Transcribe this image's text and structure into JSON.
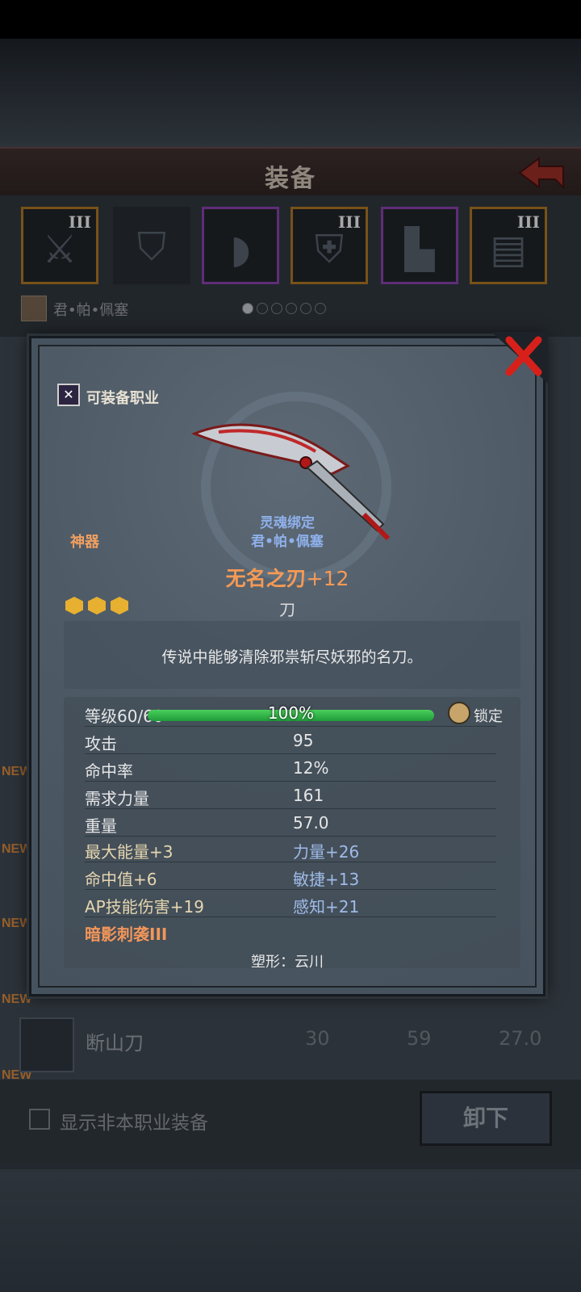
{
  "header": {
    "title": "装备"
  },
  "slots": [
    {
      "tier": "III"
    },
    {
      "tier": ""
    },
    {
      "tier": ""
    },
    {
      "tier": "III"
    },
    {
      "tier": ""
    },
    {
      "tier": "III"
    }
  ],
  "character": {
    "name": "君•帕•佩塞"
  },
  "list": {
    "new_tag": "NEW",
    "row": {
      "name": "断山刀",
      "v1": "30",
      "v2": "59",
      "v3": "27.0"
    }
  },
  "bottom": {
    "show_other_label": "显示非本职业装备",
    "unequip_label": "卸下"
  },
  "popup": {
    "class_label": "可装备职业",
    "rarity": "神器",
    "soulbound": "灵魂绑定",
    "bound_to": "君•帕•佩塞",
    "item_name": "无名之刃",
    "item_plus": "+12",
    "weapon_type": "刀",
    "stars": 3,
    "description": "传说中能够清除邪祟斩尽妖邪的名刀。",
    "level_label": "等级60/60",
    "level_progress": 1.0,
    "level_percent": "100%",
    "lock_label": "锁定",
    "stats": [
      {
        "label": "攻击",
        "value": "95"
      },
      {
        "label": "命中率",
        "value": "12%"
      },
      {
        "label": "需求力量",
        "value": "161"
      },
      {
        "label": "重量",
        "value": "57.0"
      }
    ],
    "bonuses": [
      {
        "left": "最大能量+3",
        "right": "力量+26"
      },
      {
        "left": "命中值+6",
        "right": "敏捷+13"
      },
      {
        "left": "AP技能伤害+19",
        "right": "感知+21"
      }
    ],
    "skill": "暗影刺袭III",
    "reforge": "塑形：云川"
  },
  "colors": {
    "rarity": "#f0a060",
    "bonus": "#9fbbe8",
    "bar": "#2fb84a"
  }
}
